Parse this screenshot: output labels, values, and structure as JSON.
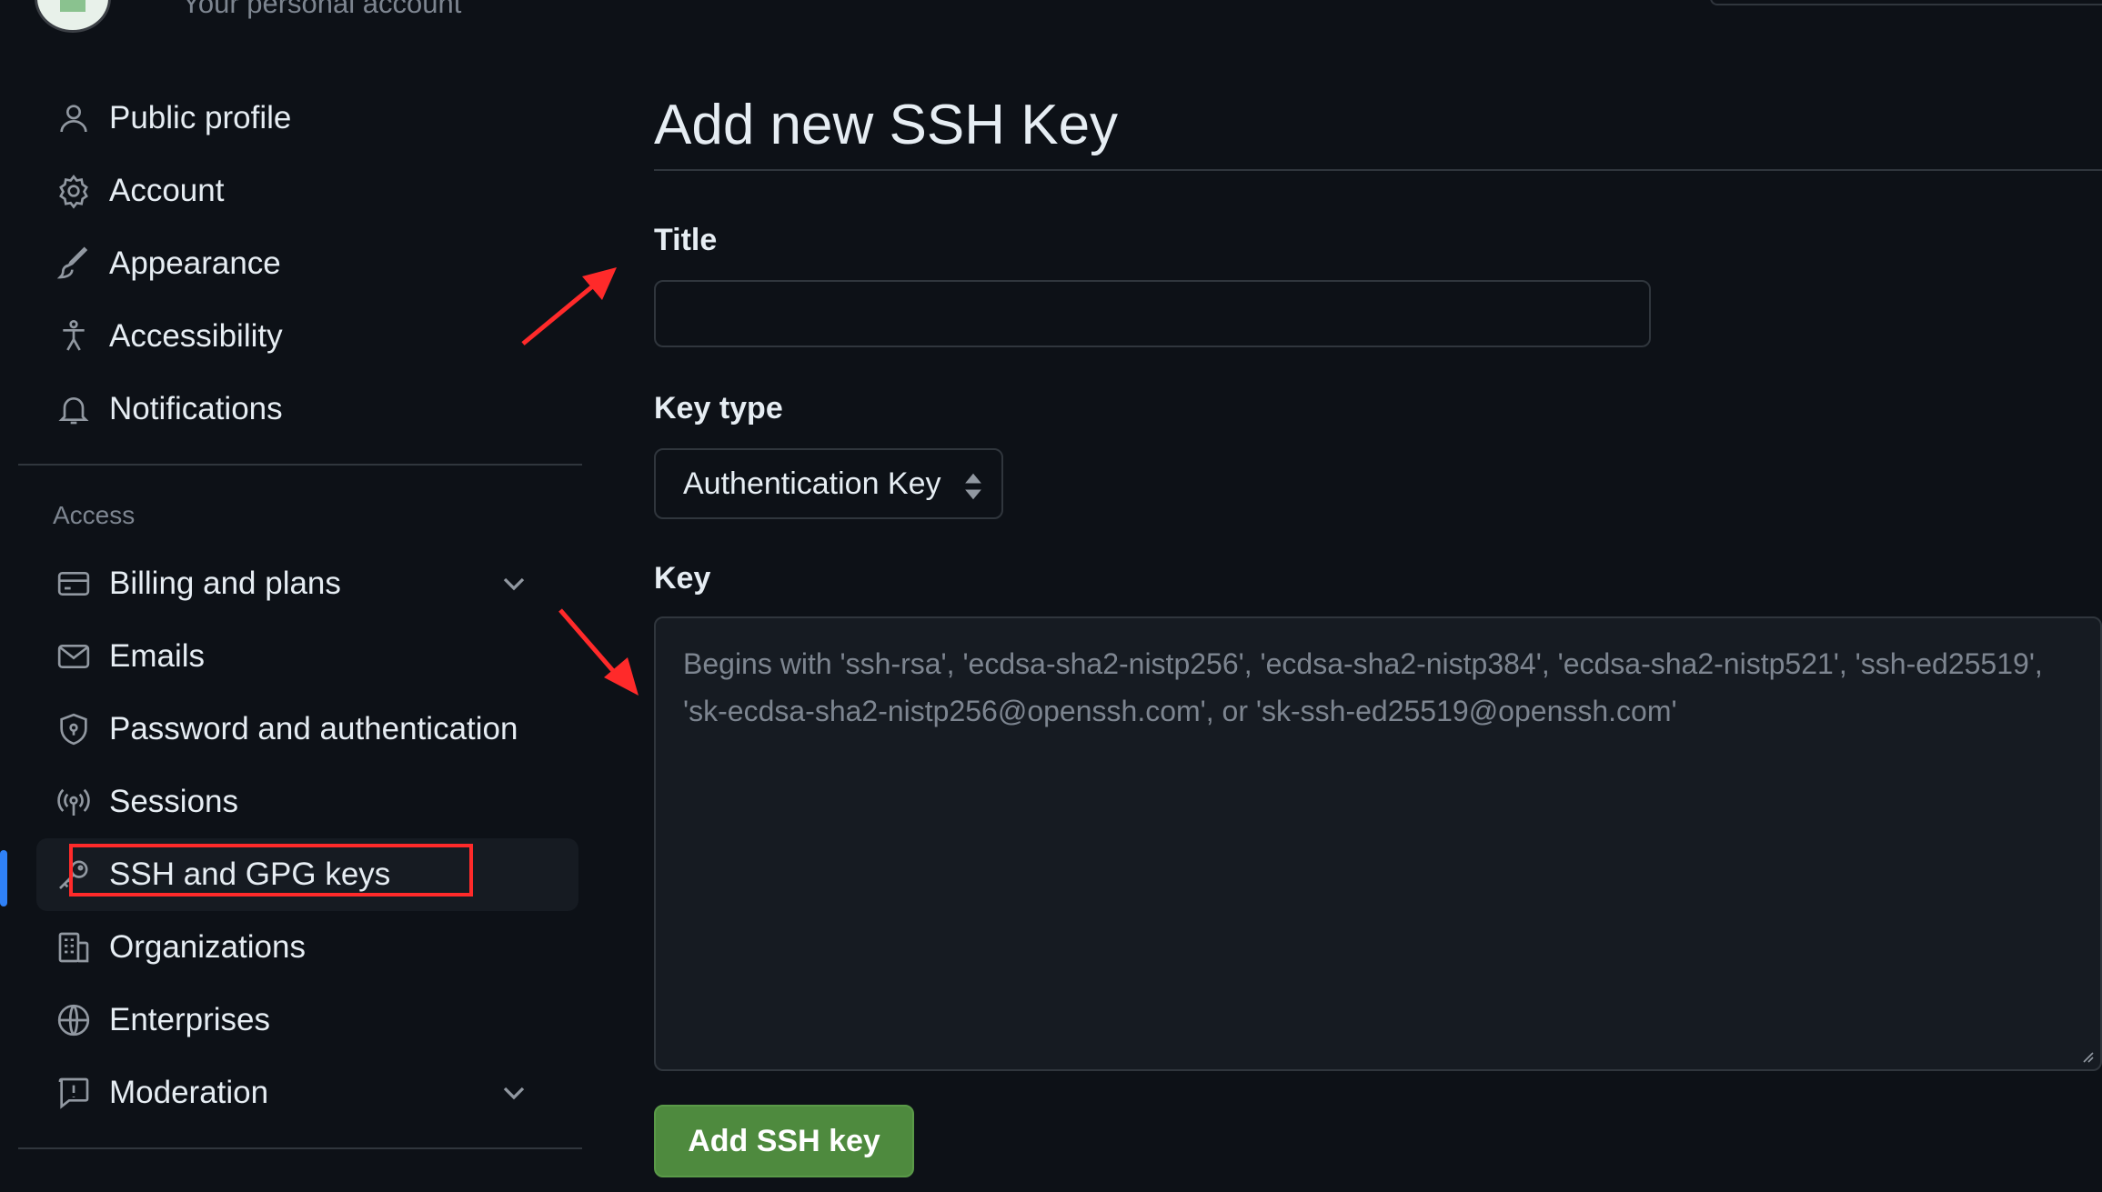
{
  "header": {
    "subtitle": "Your personal account"
  },
  "sidebar": {
    "items": [
      {
        "label": "Public profile",
        "icon": "person-icon"
      },
      {
        "label": "Account",
        "icon": "gear-icon"
      },
      {
        "label": "Appearance",
        "icon": "paintbrush-icon"
      },
      {
        "label": "Accessibility",
        "icon": "accessibility-icon"
      },
      {
        "label": "Notifications",
        "icon": "bell-icon"
      }
    ],
    "access_label": "Access",
    "access_items": [
      {
        "label": "Billing and plans",
        "icon": "credit-card-icon"
      },
      {
        "label": "Emails",
        "icon": "mail-icon"
      },
      {
        "label": "Password and authentication",
        "icon": "shield-icon"
      },
      {
        "label": "Sessions",
        "icon": "broadcast-icon"
      },
      {
        "label": "SSH and GPG keys",
        "icon": "key-icon"
      },
      {
        "label": "Organizations",
        "icon": "organization-icon"
      },
      {
        "label": "Enterprises",
        "icon": "globe-icon"
      },
      {
        "label": "Moderation",
        "icon": "report-icon"
      }
    ]
  },
  "main": {
    "title": "Add new SSH Key",
    "title_field": {
      "label": "Title",
      "value": ""
    },
    "key_type": {
      "label": "Key type",
      "selected": "Authentication Key"
    },
    "key_field": {
      "label": "Key",
      "placeholder": "Begins with 'ssh-rsa', 'ecdsa-sha2-nistp256', 'ecdsa-sha2-nistp384', 'ecdsa-sha2-nistp521', 'ssh-ed25519', 'sk-ecdsa-sha2-nistp256@openssh.com', or 'sk-ssh-ed25519@openssh.com'"
    },
    "submit_label": "Add SSH key"
  },
  "colors": {
    "background": "#0d1117",
    "accent_active": "#2f81f7",
    "button_green": "#4e8a3e",
    "annotation_red": "#ff2a2a"
  }
}
